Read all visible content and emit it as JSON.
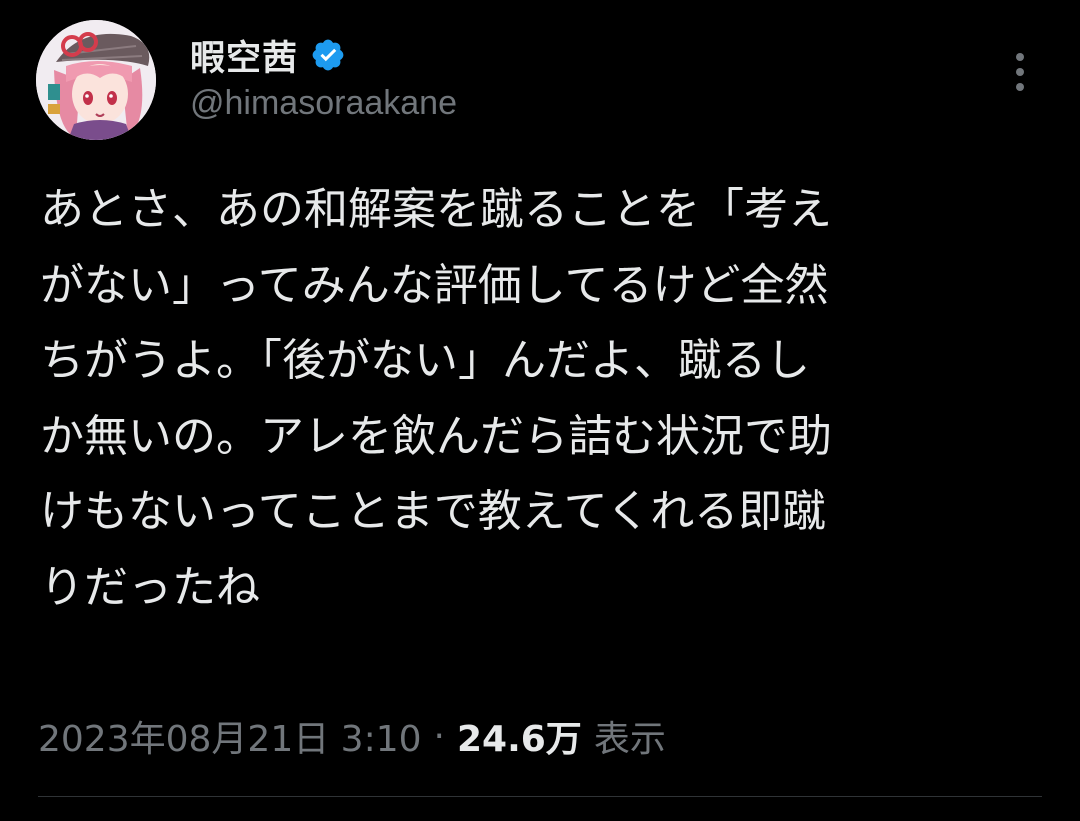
{
  "user": {
    "display_name": "暇空茜",
    "handle": "@himasoraakane",
    "verified": true
  },
  "tweet": {
    "text_lines": [
      "あとさ、あの和解案を蹴ることを「考え",
      "がない」ってみんな評価してるけど全然",
      "ちがうよ。「後がない」んだよ、蹴るし",
      "か無いの。アレを飲んだら詰む状況で助",
      "けもないってことまで教えてくれる即蹴",
      "りだったね"
    ]
  },
  "meta": {
    "datetime": "2023年08月21日 3:10",
    "separator": "·",
    "views_count": "24.6万",
    "views_label": "表示"
  },
  "colors": {
    "background": "#000000",
    "primary_text": "#e7e9ea",
    "secondary_text": "#71767b",
    "verified_blue": "#1d9bf0",
    "divider": "#2f3336"
  },
  "icons": {
    "verified": "verified-badge-icon",
    "more": "more-vertical-icon",
    "avatar": "user-avatar"
  }
}
